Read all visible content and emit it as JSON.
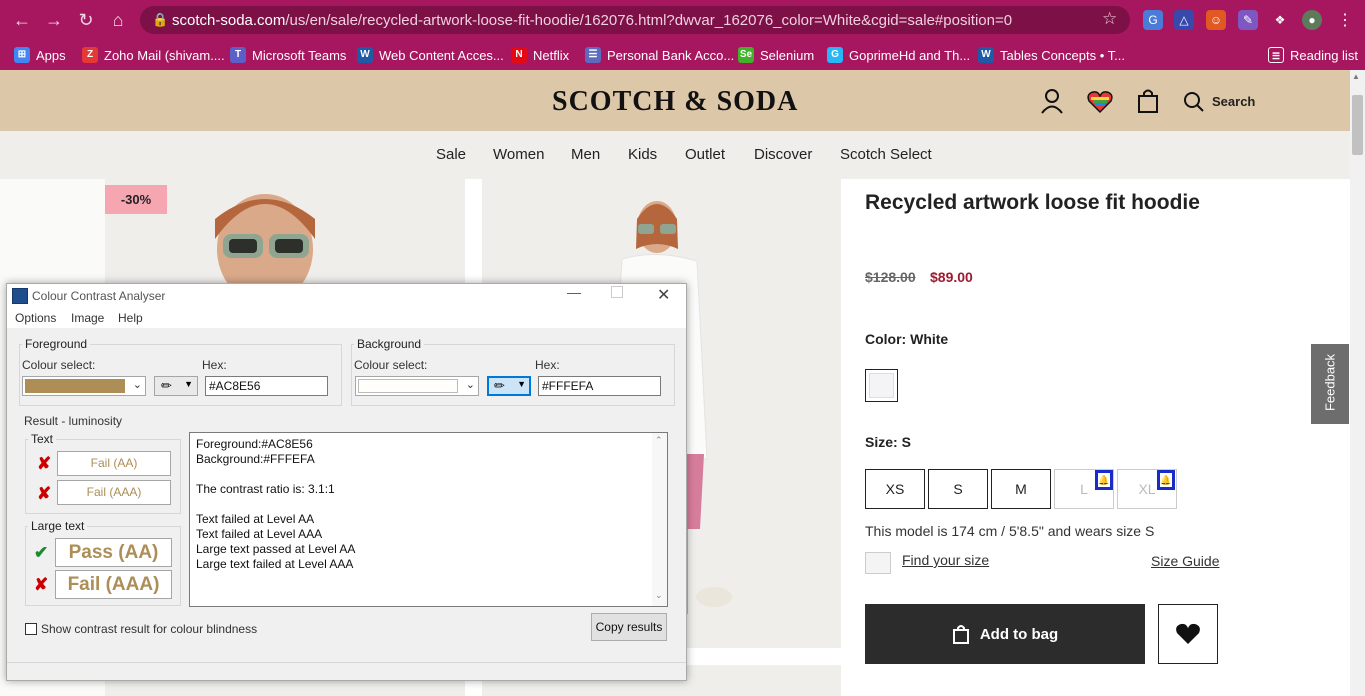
{
  "browser": {
    "url_host": "scotch-soda.com",
    "url_path": "/us/en/sale/recycled-artwork-loose-fit-hoodie/162076.html?dwvar_162076_color=White&cgid=sale#position=0",
    "bookmarks": [
      {
        "label": "Apps",
        "icon": "apps-grid-icon",
        "color": "#4285f4"
      },
      {
        "label": "Zoho Mail (shivam....",
        "icon": "zoho-icon",
        "color": "#e53935"
      },
      {
        "label": "Microsoft Teams",
        "icon": "teams-icon",
        "color": "#5b5fc7"
      },
      {
        "label": "Web Content Acces...",
        "icon": "w3c-icon",
        "color": "#1f5aa6"
      },
      {
        "label": "Netflix",
        "icon": "netflix-icon",
        "color": "#e50914"
      },
      {
        "label": "Personal Bank Acco...",
        "icon": "bank-icon",
        "color": "#5c6bc0"
      },
      {
        "label": "Selenium",
        "icon": "selenium-icon",
        "color": "#43b02a"
      },
      {
        "label": "GoprimeHd and Th...",
        "icon": "goprime-icon",
        "color": "#29b6f6"
      },
      {
        "label": "Tables Concepts • T...",
        "icon": "w3c-icon",
        "color": "#1f5aa6"
      }
    ],
    "reading_list": "Reading list"
  },
  "site": {
    "logo": "SCOTCH & SODA",
    "search_label": "Search",
    "menu": [
      "Sale",
      "Women",
      "Men",
      "Kids",
      "Outlet",
      "Discover",
      "Scotch Select"
    ],
    "feedback": "Feedback"
  },
  "product": {
    "badge": "-30%",
    "title": "Recycled artwork loose fit hoodie",
    "price_old": "$128.00",
    "price_new": "$89.00",
    "color_label": "Color: White",
    "size_label": "Size: S",
    "sizes": [
      "XS",
      "S",
      "M",
      "L",
      "XL"
    ],
    "model_info": "This model is 174 cm / 5'8.5\" and wears size S",
    "find_size": "Find your size",
    "size_guide": "Size Guide",
    "add_to_bag": "Add to bag"
  },
  "cca": {
    "title": "Colour Contrast Analyser",
    "menu": [
      "Options",
      "Image",
      "Help"
    ],
    "foreground": {
      "heading": "Foreground",
      "colour_select": "Colour select:",
      "hex_label": "Hex:",
      "hex_value": "#AC8E56",
      "swatch": "#AC8E56"
    },
    "background": {
      "heading": "Background",
      "colour_select": "Colour select:",
      "hex_label": "Hex:",
      "hex_value": "#FFFEFA",
      "swatch": "#FFFEFA"
    },
    "result_heading": "Result - luminosity",
    "text_heading": "Text",
    "text_aa": "Fail (AA)",
    "text_aaa": "Fail (AAA)",
    "large_heading": "Large text",
    "large_aa": "Pass (AA)",
    "large_aaa": "Fail (AAA)",
    "result_text": "Foreground:#AC8E56\nBackground:#FFFEFA\n\nThe contrast ratio is: 3.1:1\n\nText failed at Level AA\nText failed at Level AAA\nLarge text passed at Level AA\nLarge text failed at Level AAA",
    "colour_blind": "Show contrast result for colour blindness",
    "copy": "Copy results"
  }
}
